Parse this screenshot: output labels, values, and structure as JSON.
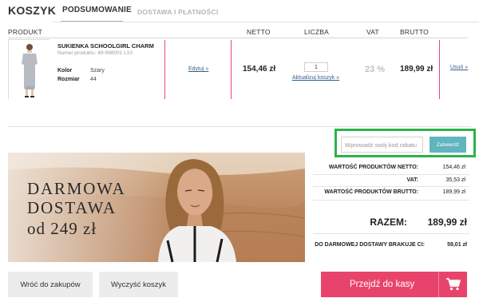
{
  "tabs": {
    "main": "KOSZYK",
    "active": "PODSUMOWANIE",
    "disabled": "DOSTAWA I PŁATNOŚCI"
  },
  "columns": {
    "produkt": "PRODUKT",
    "netto": "NETTO",
    "liczba": "LICZBA",
    "vat": "VAT",
    "brutto": "BRUTTO"
  },
  "product": {
    "name": "SUKIENKA SCHOOLGIRL CHARM",
    "number": "Numer produktu: 49-998001 L10",
    "color_label": "Kolor",
    "color_value": "Szary",
    "size_label": "Rozmiar",
    "size_value": "44",
    "edit": "Edytuj »",
    "netto": "154,46 zł",
    "quantity": "1",
    "update": "Aktualizuj koszyk »",
    "vat": "23 %",
    "brutto": "189,99 zł",
    "remove": "Usuń »",
    "image_icon": "dress-thumbnail-icon"
  },
  "coupon": {
    "placeholder": "Wprowadź swój kod rabatu",
    "button": "Zatwierdź",
    "highlight_color": "#2db24a",
    "button_color": "#60b5bf"
  },
  "banner": {
    "line1": "DARMOWA",
    "line2": "DOSTAWA",
    "line3": "od 249 zł"
  },
  "summary": {
    "netto_label": "WARTOŚĆ PRODUKTÓW NETTO:",
    "netto_value": "154,46 zł",
    "vat_label": "VAT:",
    "vat_value": "35,53 zł",
    "brutto_label": "WARTOŚĆ PRODUKTÓW BRUTTO:",
    "brutto_value": "189,99 zł",
    "total_label": "RAZEM:",
    "total_value": "189,99 zł",
    "free_shipping_label": "DO DARMOWEJ DOSTAWY BRAKUJE CI:",
    "free_shipping_value": "59,01 zł"
  },
  "buttons": {
    "back": "Wróć do zakupów",
    "clear": "Wyczyść koszyk",
    "checkout": "Przejdź do kasy",
    "checkout_color": "#e8446b",
    "checkout_icon": "cart-icon"
  }
}
